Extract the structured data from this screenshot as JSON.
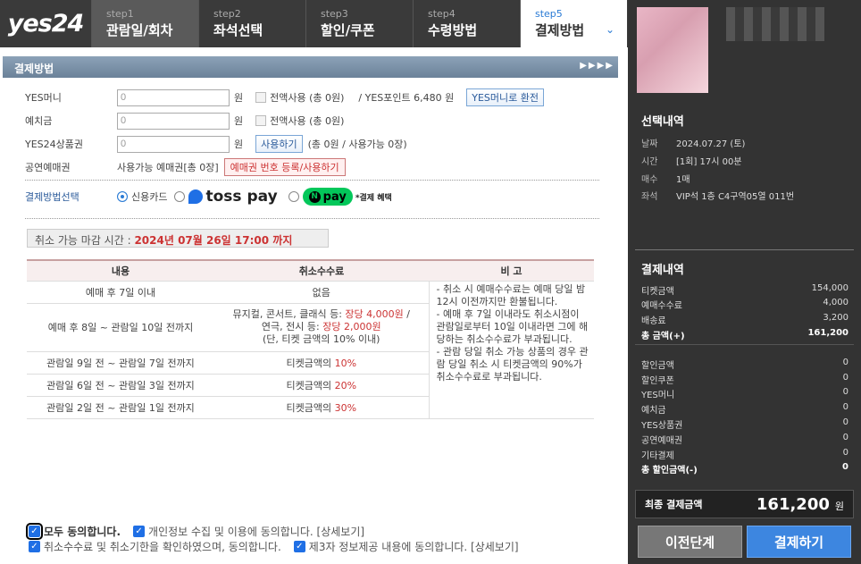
{
  "logo": "yes24",
  "steps": [
    {
      "num": "step1",
      "label": "관람일/회차"
    },
    {
      "num": "step2",
      "label": "좌석선택"
    },
    {
      "num": "step3",
      "label": "할인/쿠폰"
    },
    {
      "num": "step4",
      "label": "수령방법"
    },
    {
      "num": "step5",
      "label": "결제방법"
    }
  ],
  "section_title": "결제방법",
  "payment": {
    "yesmoney": {
      "label": "YES머니",
      "value": "0",
      "unit": "원",
      "all_use": "전액사용 (총 0원)",
      "points": "/ YES포인트 6,480 원",
      "convert_btn": "YES머니로 환전"
    },
    "deposit": {
      "label": "예치금",
      "value": "0",
      "unit": "원",
      "all_use": "전액사용 (총 0원)"
    },
    "giftcard": {
      "label": "YES24상품권",
      "value": "0",
      "unit": "원",
      "use_btn": "사용하기",
      "info": "(총 0원 / 사용가능 0장)"
    },
    "voucher": {
      "label": "공연예매권",
      "info": "사용가능 예매권[총 0장]",
      "reg_btn": "예매권 번호 등록/사용하기"
    },
    "method": {
      "label": "결제방법선택",
      "card": "신용카드",
      "toss": "toss pay",
      "npay": "pay",
      "benefit": "*결제 혜택"
    }
  },
  "cancel_deadline": {
    "label": "취소 가능 마감 시간 :",
    "value": "2024년 07월 26일 17:00 까지"
  },
  "cancel_table": {
    "headers": [
      "내용",
      "취소수수료",
      "비 고"
    ],
    "rows": [
      {
        "c": "예매 후 7일 이내",
        "f": "없음"
      },
      {
        "c": "예매 후 8일 ~ 관람일 10일 전까지",
        "f1": "뮤지컬, 콘서트, 클래식 등: ",
        "r1": "장당 4,000원",
        "f1b": " /",
        "f2": "연극, 전시 등: ",
        "r2": "장당 2,000원",
        "f3": "(단, 티켓 금액의 10% 이내)"
      },
      {
        "c": "관람일 9일 전 ~ 관람일 7일 전까지",
        "f": "티켓금액의 ",
        "r": "10%"
      },
      {
        "c": "관람일 6일 전 ~ 관람일 3일 전까지",
        "f": "티켓금액의 ",
        "r": "20%"
      },
      {
        "c": "관람일 2일 전 ~ 관람일 1일 전까지",
        "f": "티켓금액의 ",
        "r": "30%"
      }
    ],
    "note": "- 취소 시 예매수수료는 예매 당일 밤 12시 이전까지만 환불됩니다.\n- 예매 후 7일 이내라도 취소시점이 관람일로부터 10일 이내라면 그에 해당하는 취소수수료가 부과됩니다.\n- 관람 당일 취소 가능 상품의 경우 관람 당일 취소 시 티켓금액의 90%가 취소수수료로 부과됩니다."
  },
  "agreements": {
    "all": "모두 동의합니다.",
    "privacy": "개인정보 수집 및 이용에 동의합니다. [상세보기]",
    "cancel_fee": "취소수수료 및 취소기한을 확인하였으며, 동의합니다.",
    "third_party": "제3자 정보제공 내용에 동의합니다. [상세보기]"
  },
  "summary": {
    "title": "선택내역",
    "items": [
      {
        "k": "날짜",
        "v": "2024.07.27 (토)"
      },
      {
        "k": "시간",
        "v": "[1회] 17시 00분"
      },
      {
        "k": "매수",
        "v": "1매"
      },
      {
        "k": "좌석",
        "v": "VIP석 1층 C4구역05열 011번"
      }
    ]
  },
  "price": {
    "title": "결제내역",
    "lines": [
      {
        "k": "티켓금액",
        "v": "154,000"
      },
      {
        "k": "예매수수료",
        "v": "4,000"
      },
      {
        "k": "배송료",
        "v": "3,200"
      },
      {
        "k": "총 금액(+)",
        "v": "161,200"
      }
    ],
    "discounts": [
      {
        "k": "할인금액",
        "v": "0"
      },
      {
        "k": "할인쿠폰",
        "v": "0"
      },
      {
        "k": "YES머니",
        "v": "0"
      },
      {
        "k": "예치금",
        "v": "0"
      },
      {
        "k": "YES상품권",
        "v": "0"
      },
      {
        "k": "공연예매권",
        "v": "0"
      },
      {
        "k": "기타결제",
        "v": "0"
      },
      {
        "k": "총 할인금액(-)",
        "v": "0"
      }
    ],
    "final_label": "최종 결제금액",
    "final_value": "161,200",
    "final_unit": "원"
  },
  "buttons": {
    "prev": "이전단계",
    "pay": "결제하기"
  }
}
